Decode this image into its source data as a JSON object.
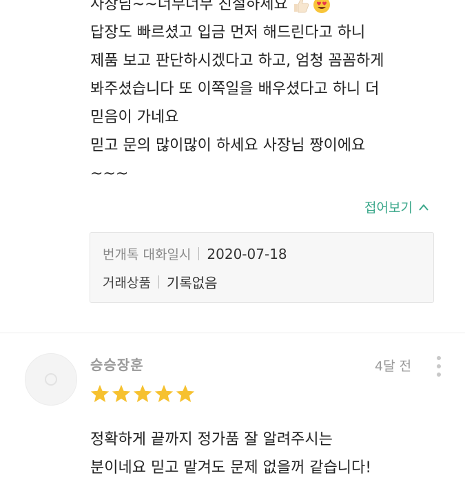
{
  "review1": {
    "lines": [
      "사장님~~너무너무 친절하세요",
      "답장도 빠르셨고 입금 먼저 해드린다고 하니",
      "제품 보고 판단하시겠다고 하고, 엄청 꼼꼼하게",
      "봐주셨습니다 또 이쪽일을 배우셨다고 하니 더",
      "믿음이 가네요",
      "믿고 문의 많이많이 하세요 사장님 짱이에요",
      "~~~"
    ],
    "emojis": [
      "thumbs-up-icon",
      "heart-eyes-icon"
    ],
    "collapse_label": "접어보기",
    "meta": {
      "chat_label": "번개톡 대화일시",
      "chat_date": "2020-07-18",
      "product_label": "거래상품",
      "product_value": "기록없음"
    }
  },
  "review2": {
    "reviewer": "승승장훈",
    "time_ago": "4달 전",
    "rating": 5,
    "lines": [
      "정확하게 끝까지 정가품 잘 알려주시는",
      "분이네요 믿고 맡겨도 문제 없을꺼 같습니다!"
    ]
  },
  "colors": {
    "accent": "#3aa78a",
    "star": "#f6c12f",
    "meta_bg": "#f7f7f7"
  }
}
